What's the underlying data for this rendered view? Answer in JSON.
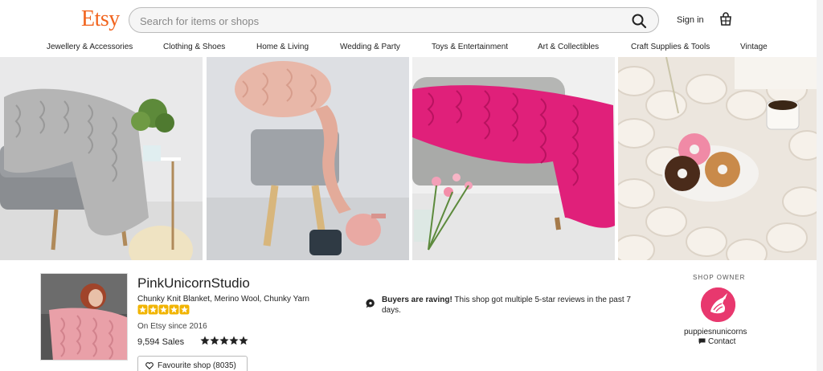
{
  "header": {
    "logo": "Etsy",
    "search_placeholder": "Search for items or shops",
    "signin": "Sign in"
  },
  "nav": [
    "Jewellery & Accessories",
    "Clothing & Shoes",
    "Home & Living",
    "Wedding & Party",
    "Toys & Entertainment",
    "Art & Collectibles",
    "Craft Supplies & Tools",
    "Vintage"
  ],
  "shop": {
    "name": "PinkUnicornStudio",
    "tagline": "Chunky Knit Blanket, Merino Wool, Chunky Yarn",
    "since": "On Etsy since 2016",
    "sales": "9,594 Sales",
    "rating": 5,
    "favourite_label": "Favourite shop (8035)"
  },
  "notice": {
    "bold": "Buyers are raving!",
    "text": " This shop got multiple 5-star reviews in the past 7 days."
  },
  "owner": {
    "label": "SHOP OWNER",
    "name": "puppiesnunicorns",
    "contact": "Contact"
  },
  "colors": {
    "brand": "#f1641e",
    "owner_avatar": "#e8386e",
    "star_gold": "#f1b400"
  }
}
